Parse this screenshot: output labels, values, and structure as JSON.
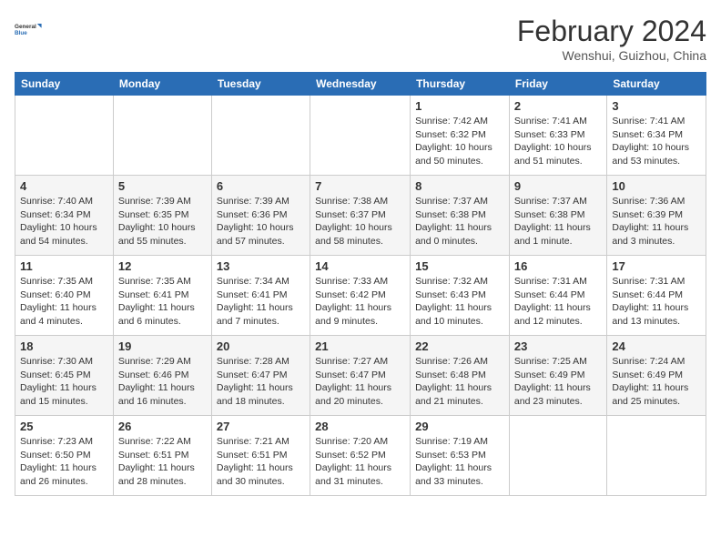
{
  "header": {
    "logo_line1": "General",
    "logo_line2": "Blue",
    "month_year": "February 2024",
    "location": "Wenshui, Guizhou, China"
  },
  "days_of_week": [
    "Sunday",
    "Monday",
    "Tuesday",
    "Wednesday",
    "Thursday",
    "Friday",
    "Saturday"
  ],
  "weeks": [
    [
      {
        "day": "",
        "info": ""
      },
      {
        "day": "",
        "info": ""
      },
      {
        "day": "",
        "info": ""
      },
      {
        "day": "",
        "info": ""
      },
      {
        "day": "1",
        "info": "Sunrise: 7:42 AM\nSunset: 6:32 PM\nDaylight: 10 hours and 50 minutes."
      },
      {
        "day": "2",
        "info": "Sunrise: 7:41 AM\nSunset: 6:33 PM\nDaylight: 10 hours and 51 minutes."
      },
      {
        "day": "3",
        "info": "Sunrise: 7:41 AM\nSunset: 6:34 PM\nDaylight: 10 hours and 53 minutes."
      }
    ],
    [
      {
        "day": "4",
        "info": "Sunrise: 7:40 AM\nSunset: 6:34 PM\nDaylight: 10 hours and 54 minutes."
      },
      {
        "day": "5",
        "info": "Sunrise: 7:39 AM\nSunset: 6:35 PM\nDaylight: 10 hours and 55 minutes."
      },
      {
        "day": "6",
        "info": "Sunrise: 7:39 AM\nSunset: 6:36 PM\nDaylight: 10 hours and 57 minutes."
      },
      {
        "day": "7",
        "info": "Sunrise: 7:38 AM\nSunset: 6:37 PM\nDaylight: 10 hours and 58 minutes."
      },
      {
        "day": "8",
        "info": "Sunrise: 7:37 AM\nSunset: 6:38 PM\nDaylight: 11 hours and 0 minutes."
      },
      {
        "day": "9",
        "info": "Sunrise: 7:37 AM\nSunset: 6:38 PM\nDaylight: 11 hours and 1 minute."
      },
      {
        "day": "10",
        "info": "Sunrise: 7:36 AM\nSunset: 6:39 PM\nDaylight: 11 hours and 3 minutes."
      }
    ],
    [
      {
        "day": "11",
        "info": "Sunrise: 7:35 AM\nSunset: 6:40 PM\nDaylight: 11 hours and 4 minutes."
      },
      {
        "day": "12",
        "info": "Sunrise: 7:35 AM\nSunset: 6:41 PM\nDaylight: 11 hours and 6 minutes."
      },
      {
        "day": "13",
        "info": "Sunrise: 7:34 AM\nSunset: 6:41 PM\nDaylight: 11 hours and 7 minutes."
      },
      {
        "day": "14",
        "info": "Sunrise: 7:33 AM\nSunset: 6:42 PM\nDaylight: 11 hours and 9 minutes."
      },
      {
        "day": "15",
        "info": "Sunrise: 7:32 AM\nSunset: 6:43 PM\nDaylight: 11 hours and 10 minutes."
      },
      {
        "day": "16",
        "info": "Sunrise: 7:31 AM\nSunset: 6:44 PM\nDaylight: 11 hours and 12 minutes."
      },
      {
        "day": "17",
        "info": "Sunrise: 7:31 AM\nSunset: 6:44 PM\nDaylight: 11 hours and 13 minutes."
      }
    ],
    [
      {
        "day": "18",
        "info": "Sunrise: 7:30 AM\nSunset: 6:45 PM\nDaylight: 11 hours and 15 minutes."
      },
      {
        "day": "19",
        "info": "Sunrise: 7:29 AM\nSunset: 6:46 PM\nDaylight: 11 hours and 16 minutes."
      },
      {
        "day": "20",
        "info": "Sunrise: 7:28 AM\nSunset: 6:47 PM\nDaylight: 11 hours and 18 minutes."
      },
      {
        "day": "21",
        "info": "Sunrise: 7:27 AM\nSunset: 6:47 PM\nDaylight: 11 hours and 20 minutes."
      },
      {
        "day": "22",
        "info": "Sunrise: 7:26 AM\nSunset: 6:48 PM\nDaylight: 11 hours and 21 minutes."
      },
      {
        "day": "23",
        "info": "Sunrise: 7:25 AM\nSunset: 6:49 PM\nDaylight: 11 hours and 23 minutes."
      },
      {
        "day": "24",
        "info": "Sunrise: 7:24 AM\nSunset: 6:49 PM\nDaylight: 11 hours and 25 minutes."
      }
    ],
    [
      {
        "day": "25",
        "info": "Sunrise: 7:23 AM\nSunset: 6:50 PM\nDaylight: 11 hours and 26 minutes."
      },
      {
        "day": "26",
        "info": "Sunrise: 7:22 AM\nSunset: 6:51 PM\nDaylight: 11 hours and 28 minutes."
      },
      {
        "day": "27",
        "info": "Sunrise: 7:21 AM\nSunset: 6:51 PM\nDaylight: 11 hours and 30 minutes."
      },
      {
        "day": "28",
        "info": "Sunrise: 7:20 AM\nSunset: 6:52 PM\nDaylight: 11 hours and 31 minutes."
      },
      {
        "day": "29",
        "info": "Sunrise: 7:19 AM\nSunset: 6:53 PM\nDaylight: 11 hours and 33 minutes."
      },
      {
        "day": "",
        "info": ""
      },
      {
        "day": "",
        "info": ""
      }
    ]
  ]
}
